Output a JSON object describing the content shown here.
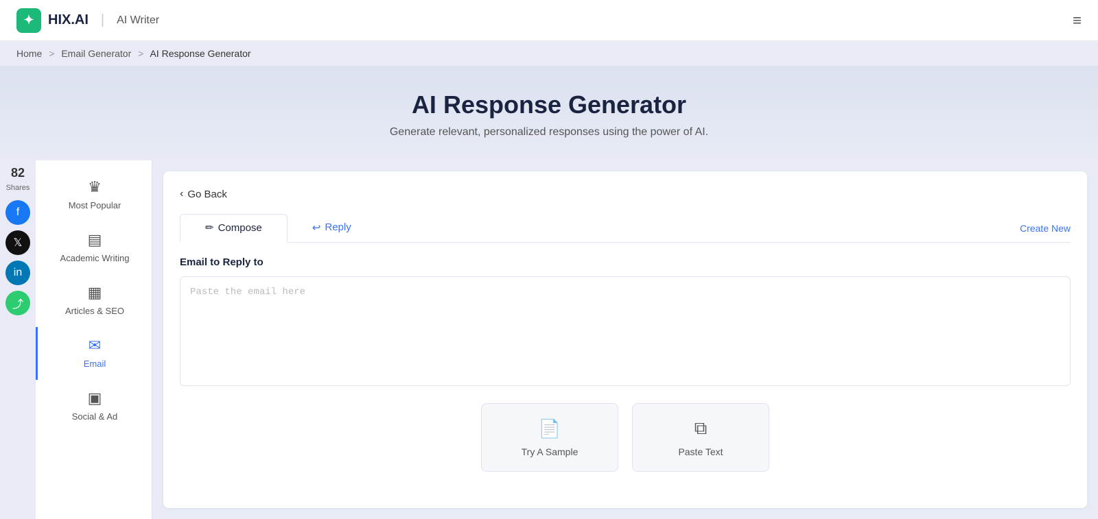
{
  "brand": {
    "logo_icon": "✦",
    "logo_text": "HIX.AI",
    "divider": "|",
    "sub_text": "AI Writer"
  },
  "topnav": {
    "menu_icon": "≡"
  },
  "breadcrumb": {
    "home": "Home",
    "sep1": ">",
    "parent": "Email Generator",
    "sep2": ">",
    "current": "AI Response Generator"
  },
  "hero": {
    "title": "AI Response Generator",
    "subtitle": "Generate relevant, personalized responses using the power of AI."
  },
  "social": {
    "count": "82",
    "label": "Shares"
  },
  "left_nav": {
    "items": [
      {
        "id": "most-popular",
        "label": "Most Popular",
        "icon": "♛"
      },
      {
        "id": "academic-writing",
        "label": "Academic Writing",
        "icon": "▤"
      },
      {
        "id": "articles-seo",
        "label": "Articles & SEO",
        "icon": "▦"
      },
      {
        "id": "email",
        "label": "Email",
        "icon": "✉",
        "active": true
      },
      {
        "id": "social-ad",
        "label": "Social & Ad",
        "icon": "▣"
      }
    ]
  },
  "content": {
    "go_back_label": "Go Back",
    "tabs": [
      {
        "id": "compose",
        "label": "Compose",
        "icon": "✏",
        "active": true
      },
      {
        "id": "reply",
        "label": "Reply",
        "icon": "↩",
        "active": false
      }
    ],
    "create_new_label": "Create New",
    "form": {
      "field_label": "Email to Reply to",
      "textarea_placeholder": "Paste the email here"
    },
    "action_cards": [
      {
        "id": "try-sample",
        "icon": "📄",
        "label": "Try A Sample"
      },
      {
        "id": "paste-text",
        "icon": "⧉",
        "label": "Paste Text"
      }
    ]
  }
}
